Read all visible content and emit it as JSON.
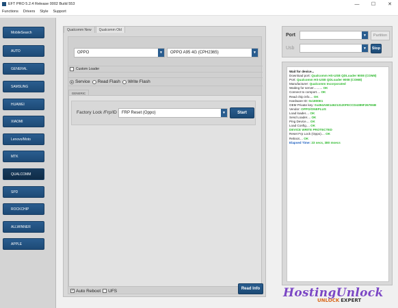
{
  "window": {
    "title": "EFT PRO 5.2.4 Release 0002 Build 553",
    "minimize": "—",
    "maximize": "☐",
    "close": "✕"
  },
  "menu": [
    "Functions",
    "Drivers",
    "Style",
    "Support"
  ],
  "sidebar": {
    "items": [
      "MobileSearch",
      "AUTO",
      "GENERAL",
      "SAMSUNG",
      "HUAWEI",
      "XIAOMI",
      "Lenovo/Moto",
      "MTK",
      "QUALCOMM",
      "SPD",
      "ROCKCHIP",
      "ALLWINNER",
      "APPLE"
    ],
    "active": "QUALCOMM"
  },
  "main": {
    "tabs": [
      "Qualcomm New",
      "Qualcomm Old"
    ],
    "brand": "OPPO",
    "model": "OPPO A95 4G (CPH2365)",
    "custom_loader": "Custom Loader",
    "modes": [
      "Service",
      "Read Flash",
      "Write Flash"
    ],
    "selected_mode": "Service",
    "subtab": "GENERIC",
    "frp_label": "Factory Lock /Frp/ID",
    "frp_value": "FRP Reset (Oppo)",
    "start": "Start",
    "auto_reboot": "Auto Reboot",
    "ufs": "UFS",
    "read_info": "Read Info"
  },
  "right": {
    "port_label": "Port",
    "usb_label": "Usb",
    "partition_button": "Partition",
    "stop_button": "Stop"
  },
  "log": [
    {
      "t": "Wait for device...",
      "cls": "c-head"
    },
    {
      "t": "Download port: ",
      "cls": "c-lbl",
      "v": "Qualcomm HS-USB QDLoader 9008 (COM8)",
      "vc": "c-val"
    },
    {
      "t": "Port: ",
      "cls": "c-lbl",
      "v": "Qualcomm HS-USB QDLoader 9008 (COM8)",
      "vc": "c-val"
    },
    {
      "t": "Manufacturer: ",
      "cls": "c-lbl",
      "v": "Qualcomm Incorporated",
      "vc": "c-val"
    },
    {
      "t": "Waiting for server.......... ",
      "cls": "c-lbl",
      "v": "OK",
      "vc": "c-ok"
    },
    {
      "t": "Connect to comport.... ",
      "cls": "c-lbl",
      "v": "OK",
      "vc": "c-ok"
    },
    {
      "t": "Read chip info.... ",
      "cls": "c-lbl",
      "v": "OK",
      "vc": "c-ok"
    },
    {
      "t": "Hardware ID: ",
      "cls": "c-lbl",
      "v": "0x1800E1",
      "vc": "c-val"
    },
    {
      "t": "OEM Private key: ",
      "cls": "c-lbl",
      "v": "0x494A5E146213120FECCD4389F267E6B",
      "vc": "c-val"
    },
    {
      "t": "Vendor: ",
      "cls": "c-lbl",
      "v": "OPPO/ONEPLUS",
      "vc": "c-val"
    },
    {
      "t": "Load loader.... ",
      "cls": "c-lbl",
      "v": "OK",
      "vc": "c-ok"
    },
    {
      "t": "Send Loader.... ",
      "cls": "c-lbl",
      "v": "OK",
      "vc": "c-ok"
    },
    {
      "t": "Ping Device.... ",
      "cls": "c-lbl",
      "v": "OK",
      "vc": "c-ok"
    },
    {
      "t": "Load Config.... ",
      "cls": "c-lbl",
      "v": "OK",
      "vc": "c-ok"
    },
    {
      "t": "    DEVICE WRITE PROTECTED",
      "cls": "c-val"
    },
    {
      "t": "Reset Frp Lock (Oppo).... ",
      "cls": "c-lbl",
      "v": "OK",
      "vc": "c-ok"
    },
    {
      "t": "Reboot.... ",
      "cls": "c-lbl",
      "v": "OK",
      "vc": "c-ok"
    },
    {
      "t": "Elapsed Time: ",
      "cls": "c-blu",
      "v": "23 secs, 380 msecs",
      "vc": "c-val"
    }
  ],
  "watermark": {
    "top": "HostingUnlock",
    "bottom_a": "UNLOCK",
    "bottom_b": "EXPERT"
  },
  "colors": {
    "accent": "#1d4a76",
    "ok": "#2db82d",
    "log_blue": "#1d5fbf"
  }
}
